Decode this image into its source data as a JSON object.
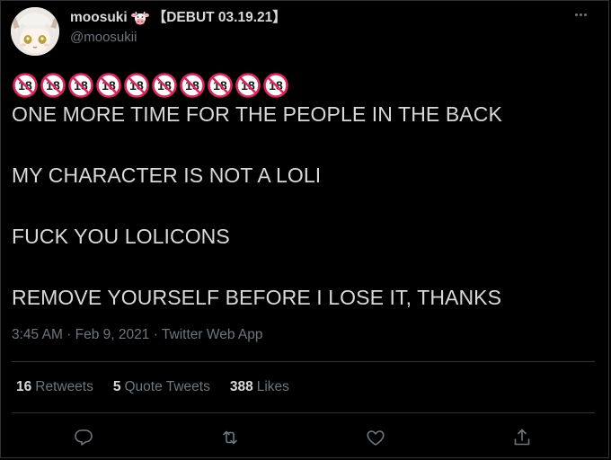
{
  "tweet": {
    "author": {
      "display_name": "moosuki",
      "name_suffix": "【DEBUT 03.19.21】",
      "handle": "@moosukii"
    },
    "emoji": "🔞",
    "emoji_count": 10,
    "lines": [
      "ONE MORE TIME FOR THE PEOPLE IN THE BACK",
      "MY CHARACTER IS NOT A LOLI",
      "FUCK YOU LOLICONS",
      "REMOVE YOURSELF BEFORE I LOSE IT, THANKS"
    ],
    "time": "3:45 AM",
    "separator": "·",
    "date": "Feb 9, 2021",
    "source": "Twitter Web App"
  },
  "stats": {
    "retweets_count": "16",
    "retweets_label": "Retweets",
    "quotes_count": "5",
    "quotes_label": "Quote Tweets",
    "likes_count": "388",
    "likes_label": "Likes"
  },
  "colors": {
    "background": "#000000",
    "text": "#d9d9d9",
    "muted": "#6e767d",
    "divider": "#2f3336",
    "emoji_red": "#e0245e"
  },
  "icons": {
    "reply": "reply-icon",
    "retweet": "retweet-icon",
    "like": "heart-icon",
    "share": "share-icon",
    "more": "more-icon",
    "cow": "cow-emoji-icon",
    "no_under_18": "no-one-under-18-icon"
  }
}
